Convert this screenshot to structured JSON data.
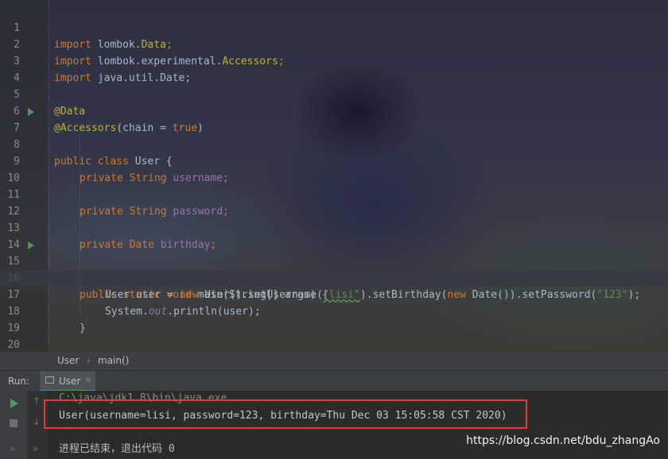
{
  "editor": {
    "line_numbers": [
      "1",
      "2",
      "3",
      "4",
      "5",
      "6",
      "7",
      "8",
      "9",
      "10",
      "11",
      "12",
      "13",
      "14",
      "15",
      "16",
      "17",
      "18",
      "19",
      "20"
    ],
    "l1": {
      "kw": "import",
      "pkg": "lombok.",
      "cls": "Data",
      "end": ";"
    },
    "l2": {
      "kw": "import",
      "pkg": "lombok.experimental.",
      "cls": "Accessors",
      "end": ";"
    },
    "l3": {
      "kw": "import",
      "pkg": "java.util.Date;"
    },
    "l5": {
      "ann": "@Data"
    },
    "l6": {
      "ann": "@Accessors",
      "open": "(chain = ",
      "val": "true",
      "close": ")"
    },
    "l7": {
      "kw": "public class",
      "name": "User {"
    },
    "l9": {
      "kw": "private String",
      "field": "username",
      "end": ";"
    },
    "l11": {
      "kw": "private String",
      "field": "password",
      "end": ";"
    },
    "l13": {
      "kw": "private Date",
      "field": "birthday",
      "end": ";"
    },
    "l15": {
      "kw": "public static void",
      "rest": "main(String[] args) {"
    },
    "l16": {
      "a": "User user = ",
      "new1": "new",
      "b": " User().setUsername(",
      "s1": "\"lisi\"",
      "c": ").setBirthday(",
      "new2": "new",
      "d": " Date()).setPassword(",
      "s2": "\"123\"",
      "e": ");"
    },
    "l17": {
      "a": "System.",
      "out": "out",
      "b": ".println(user);"
    },
    "l18": {
      "text": "}"
    },
    "l20": {
      "text": "}"
    }
  },
  "breadcrumb": {
    "class": "User",
    "sep": "›",
    "method": "main()"
  },
  "run_panel": {
    "label": "Run:",
    "tab": "User",
    "close": "×"
  },
  "console": {
    "command": "C:\\java\\jdk1.8\\bin\\java.exe ...",
    "output": "User(username=lisi, password=123, birthday=Thu Dec 03 15:05:58 CST 2020)",
    "exit": "进程已结束，退出代码 0"
  },
  "watermark": "https://blog.csdn.net/bdu_zhangAo"
}
